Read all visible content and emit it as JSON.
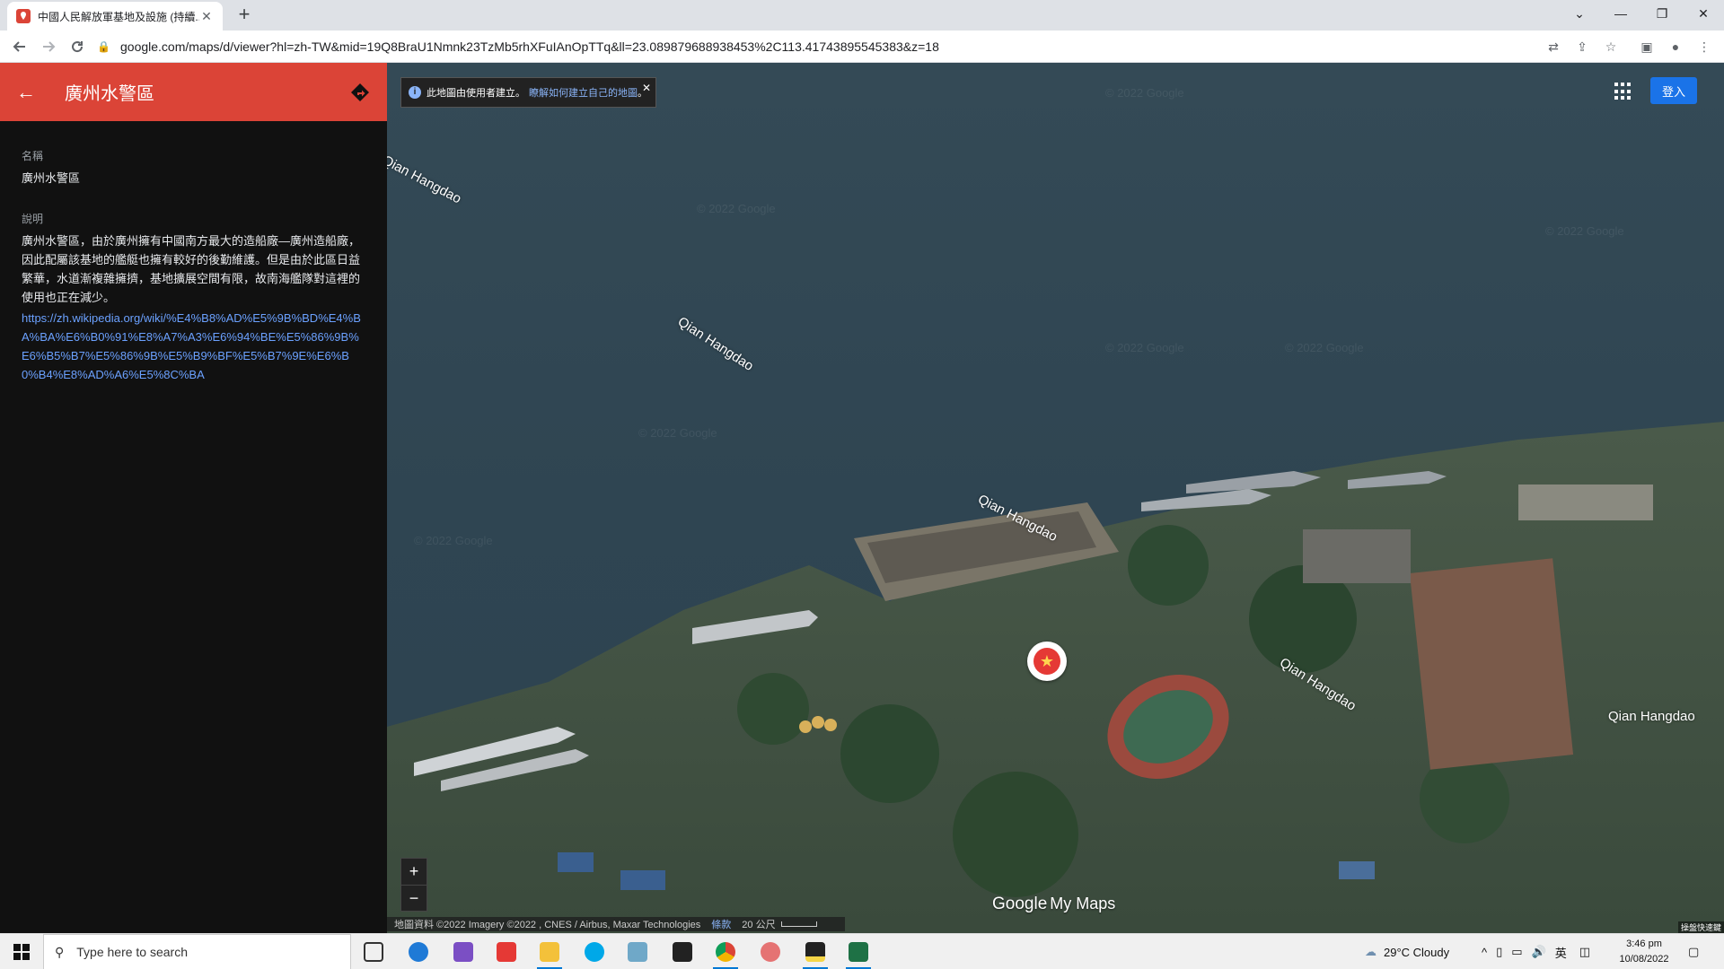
{
  "browser": {
    "tab_title": "中國人民解放軍基地及設施 (持續...",
    "new_tab": "+",
    "url": "google.com/maps/d/viewer?hl=zh-TW&mid=19Q8BraU1Nmnk23TzMb5rhXFuIAnOpTTq&ll=23.089879688938453%2C113.41743895545383&z=18"
  },
  "sidebar": {
    "title": "廣州水警區",
    "name_label": "名稱",
    "name_value": "廣州水警區",
    "desc_label": "說明",
    "desc_value": "廣州水警區，由於廣州擁有中國南方最大的造船廠—廣州造船廠，因此配屬該基地的艦艇也擁有較好的後勤維護。但是由於此區日益繁華，水道漸複雜擁擠，基地擴展空間有限，故南海艦隊對這裡的使用也正在減少。",
    "desc_link": "https://zh.wikipedia.org/wiki/%E4%B8%AD%E5%9B%BD%E4%BA%BA%E6%B0%91%E8%A7%A3%E6%94%BE%E5%86%9B%E6%B5%B7%E5%86%9B%E5%B9%BF%E5%B7%9E%E6%B0%B4%E8%AD%A6%E5%8C%BA"
  },
  "map": {
    "notice_text": "此地圖由使用者建立。",
    "notice_link": "瞭解如何建立自己的地圖",
    "notice_end": "。",
    "signin": "登入",
    "zoom_in": "+",
    "zoom_out": "−",
    "road_label": "Qian Hangdao",
    "watermark": "© 2022 Google",
    "brand_google": "Google",
    "brand_mymaps": "My Maps",
    "attribution": "地圖資料 ©2022 Imagery ©2022 , CNES / Airbus, Maxar Technologies",
    "terms": "條款",
    "scale": "20 公尺",
    "vendor": "操盤快速鍵"
  },
  "taskbar": {
    "search_placeholder": "Type here to search",
    "weather": "29°C  Cloudy",
    "ime": "英",
    "time": "3:46 pm",
    "date": "10/08/2022"
  },
  "colors": {
    "header_red": "#db4437",
    "signin_blue": "#1a73e8",
    "link_blue": "#6ba1ff"
  }
}
